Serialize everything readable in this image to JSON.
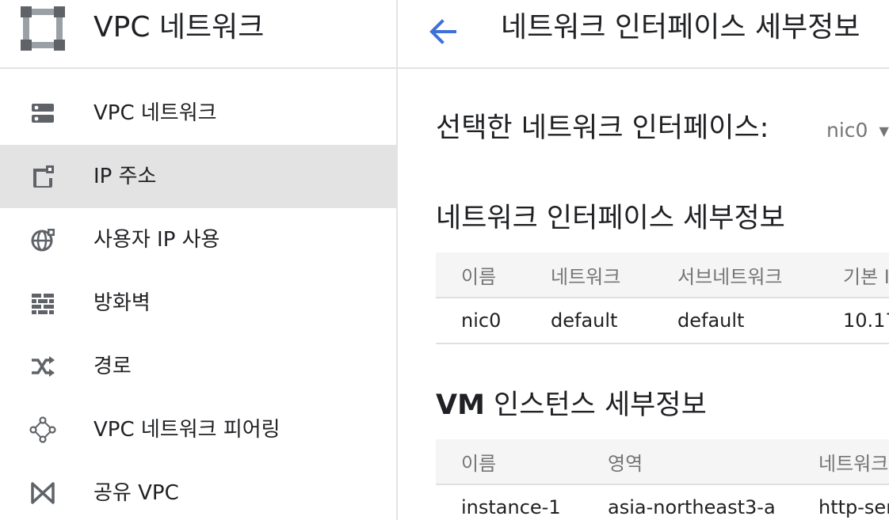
{
  "sidebar": {
    "product_title": "VPC 네트워크",
    "items": [
      {
        "label": "VPC 네트워크",
        "icon": "vpc-network-icon",
        "active": false
      },
      {
        "label": "IP 주소",
        "icon": "ip-address-icon",
        "active": true
      },
      {
        "label": "사용자 IP 사용",
        "icon": "globe-icon",
        "active": false
      },
      {
        "label": "방화벽",
        "icon": "firewall-icon",
        "active": false
      },
      {
        "label": "경로",
        "icon": "routes-icon",
        "active": false
      },
      {
        "label": "VPC 네트워크 피어링",
        "icon": "peering-icon",
        "active": false
      },
      {
        "label": "공유 VPC",
        "icon": "shared-vpc-icon",
        "active": false
      }
    ]
  },
  "header": {
    "back_icon": "arrow-back-icon",
    "title": "네트워크 인터페이스 세부정보"
  },
  "selector": {
    "label": "선택한 네트워크 인터페이스:",
    "value": "nic0"
  },
  "nic_section": {
    "title": "네트워크 인터페이스 세부정보",
    "columns": [
      "이름",
      "네트워크",
      "서브네트워크",
      "기본 I"
    ],
    "rows": [
      [
        "nic0",
        "default",
        "default",
        "10.17"
      ]
    ]
  },
  "vm_section": {
    "title_bold": "VM",
    "title_rest": " 인스턴스 세부정보",
    "columns": [
      "이름",
      "영역",
      "네트워크"
    ],
    "rows": [
      [
        "instance-1",
        "asia-northeast3-a",
        "http-ser"
      ]
    ]
  },
  "colors": {
    "accent": "#3f6fd8",
    "active_bg": "#e3e3e3",
    "icon_gray": "#5f6368"
  }
}
